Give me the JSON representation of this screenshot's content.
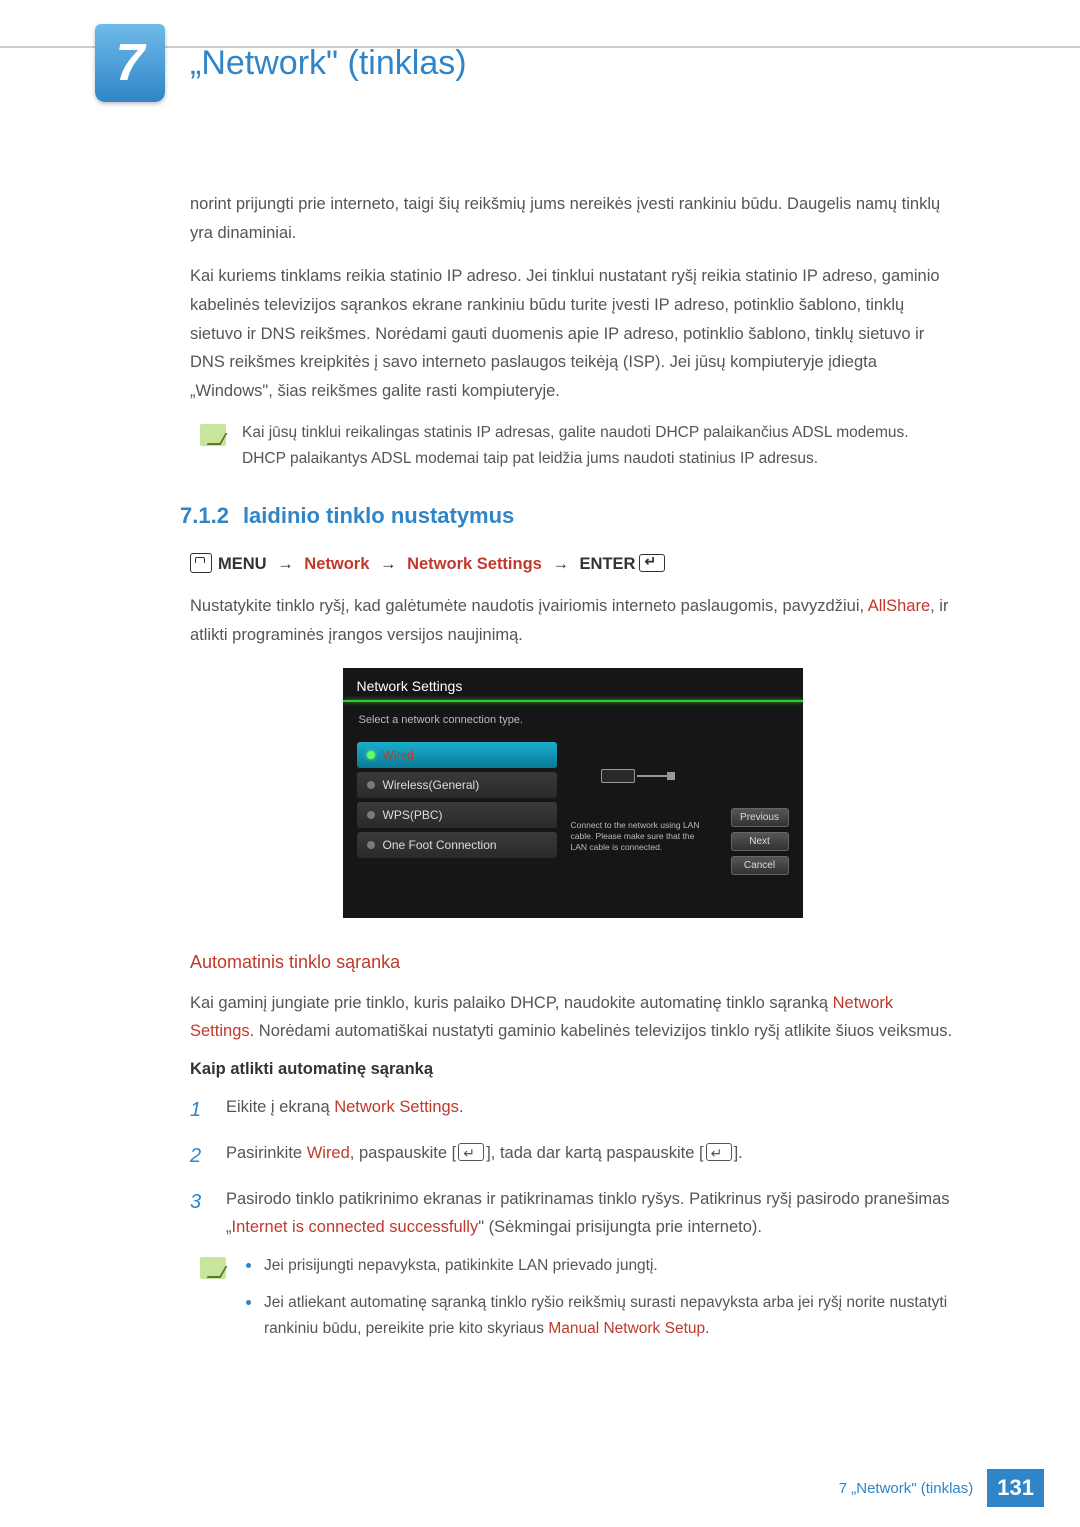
{
  "chapter": {
    "number": "7",
    "title": "„Network\" (tinklas)"
  },
  "intro": {
    "p1": "norint prijungti prie interneto, taigi šių reikšmių jums nereikės įvesti rankiniu būdu. Daugelis namų tinklų yra dinaminiai.",
    "p2": "Kai kuriems tinklams reikia statinio IP adreso. Jei tinklui nustatant ryšį reikia statinio IP adreso, gaminio kabelinės televizijos sąrankos ekrane rankiniu būdu turite įvesti IP adreso, potinklio šablono, tinklų sietuvo ir DNS reikšmes. Norėdami gauti duomenis apie IP adreso, potinklio šablono, tinklų sietuvo ir DNS reikšmes kreipkitės į savo interneto paslaugos teikėją (ISP). Jei jūsų kompiuteryje įdiegta „Windows\", šias reikšmes galite rasti kompiuteryje.",
    "note": "Kai jūsų tinklui reikalingas statinis IP adresas, galite naudoti DHCP palaikančius ADSL modemus. DHCP palaikantys ADSL modemai taip pat leidžia jums naudoti statinius IP adresus."
  },
  "section": {
    "num": "7.1.2",
    "title": "laidinio tinklo nustatymus",
    "path": {
      "menu": "MENU",
      "p1": "Network",
      "p2": "Network Settings",
      "enter": "ENTER"
    },
    "desc_pre": "Nustatykite tinklo ryšį, kad galėtumėte naudotis įvairiomis interneto paslaugomis, pavyzdžiui, ",
    "desc_accent": "AllShare",
    "desc_post": ", ir atlikti programinės įrangos versijos naujinimą."
  },
  "screenshot": {
    "title": "Network Settings",
    "subtitle": "Select a network connection type.",
    "items": [
      "Wired",
      "Wireless(General)",
      "WPS(PBC)",
      "One Foot Connection"
    ],
    "desc": "Connect to the network using LAN cable. Please make sure that the LAN cable is connected.",
    "buttons": [
      "Previous",
      "Next",
      "Cancel"
    ]
  },
  "auto": {
    "heading": "Automatinis tinklo sąranka",
    "p_pre": "Kai gaminį jungiate prie tinklo, kuris palaiko DHCP, naudokite automatinę tinklo sąranką ",
    "p_accent": "Network Settings",
    "p_post": ". Norėdami automatiškai nustatyti gaminio kabelinės televizijos tinklo ryšį atlikite šiuos veiksmus.",
    "howto": "Kaip atlikti automatinę sąranką",
    "steps": {
      "s1_pre": "Eikite į ekraną ",
      "s1_accent": "Network Settings",
      "s1_post": ".",
      "s2_pre": "Pasirinkite ",
      "s2_accent": "Wired",
      "s2_mid": ", paspauskite [",
      "s2_mid2": "], tada dar kartą paspauskite [",
      "s2_post": "].",
      "s3_pre": "Pasirodo tinklo patikrinimo ekranas ir patikrinamas tinklo ryšys. Patikrinus ryšį pasirodo pranešimas „",
      "s3_accent": "Internet is connected successfully",
      "s3_post": "\" (Sėkmingai prisijungta prie interneto)."
    },
    "notes": {
      "b1": "Jei prisijungti nepavyksta, patikinkite LAN prievado jungtį.",
      "b2_pre": "Jei atliekant automatinę sąranką tinklo ryšio reikšmių surasti nepavyksta arba jei ryšį norite nustatyti rankiniu būdu, pereikite prie kito skyriaus ",
      "b2_accent": "Manual Network Setup",
      "b2_post": "."
    }
  },
  "footer": {
    "text": "7 „Network\" (tinklas)",
    "page": "131"
  }
}
